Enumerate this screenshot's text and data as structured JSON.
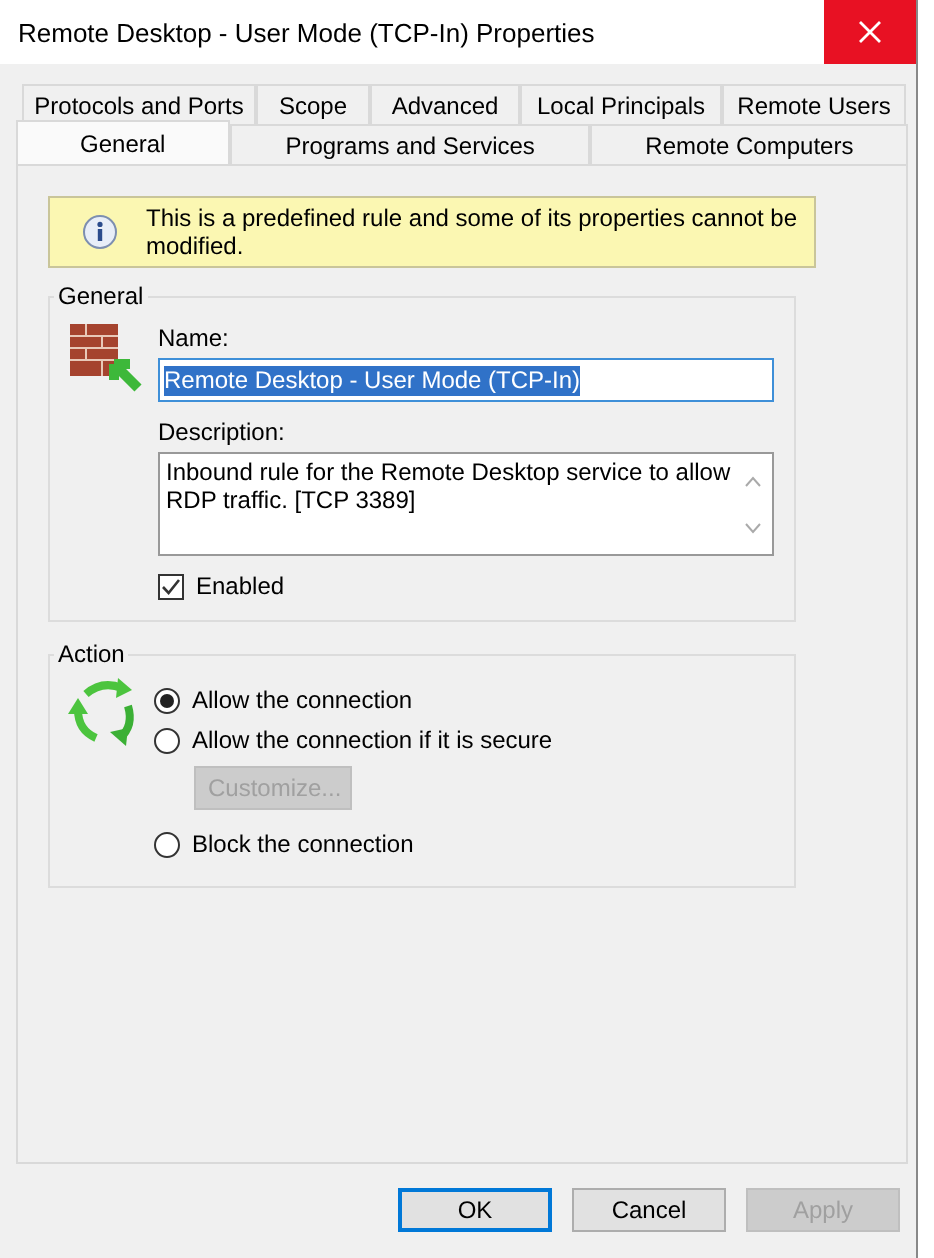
{
  "window": {
    "title": "Remote Desktop - User Mode (TCP-In) Properties"
  },
  "tab_rows": [
    [
      {
        "label": "Protocols and Ports",
        "selected": false
      },
      {
        "label": "Scope",
        "selected": false
      },
      {
        "label": "Advanced",
        "selected": false
      },
      {
        "label": "Local Principals",
        "selected": false
      },
      {
        "label": "Remote Users",
        "selected": false
      }
    ],
    [
      {
        "label": "General",
        "selected": true
      },
      {
        "label": "Programs and Services",
        "selected": false
      },
      {
        "label": "Remote Computers",
        "selected": false
      }
    ]
  ],
  "notice": "This is a predefined rule and some of its properties cannot be modified.",
  "general": {
    "legend": "General",
    "name_label": "Name:",
    "name": "Remote Desktop - User Mode (TCP-In)",
    "description_label": "Description:",
    "description": "Inbound rule for the Remote Desktop service to allow RDP traffic. [TCP 3389]",
    "enabled": {
      "label": "Enabled",
      "checked": true
    }
  },
  "action": {
    "legend": "Action",
    "options": [
      {
        "kind": "radio",
        "label": "Allow the connection",
        "selected": true
      },
      {
        "kind": "radio",
        "label": "Allow the connection if it is secure",
        "selected": false
      },
      {
        "kind": "button",
        "label": "Customize...",
        "disabled": true
      },
      {
        "kind": "radio",
        "label": "Block the connection",
        "selected": false
      }
    ]
  },
  "buttons": [
    {
      "label": "OK",
      "default": true,
      "disabled": false
    },
    {
      "label": "Cancel",
      "default": false,
      "disabled": false
    },
    {
      "label": "Apply",
      "default": false,
      "disabled": true
    }
  ]
}
